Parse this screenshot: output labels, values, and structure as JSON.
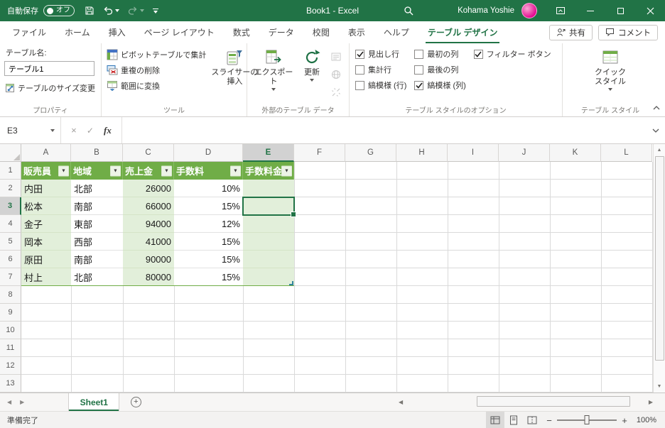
{
  "titlebar": {
    "autosave_label": "自動保存",
    "autosave_state": "オフ",
    "document_title": "Book1 -  Excel",
    "user_name": "Kohama Yoshie"
  },
  "ribbon_tabs": {
    "items": [
      "ファイル",
      "ホーム",
      "挿入",
      "ページ レイアウト",
      "数式",
      "データ",
      "校閲",
      "表示",
      "ヘルプ",
      "テーブル デザイン"
    ],
    "active_tab": "テーブル デザイン",
    "share_label": "共有",
    "comments_label": "コメント"
  },
  "ribbon": {
    "properties_group": {
      "table_name_label": "テーブル名:",
      "table_name_value": "テーブル1",
      "resize_button": "テーブルのサイズ変更",
      "group_title": "プロパティ"
    },
    "tools_group": {
      "summarize_pivot": "ピボットテーブルで集計",
      "remove_duplicates": "重複の削除",
      "convert_to_range": "範囲に変換",
      "insert_slicer": "スライサーの挿入",
      "group_title": "ツール"
    },
    "external_group": {
      "export_label": "エクスポート",
      "refresh_label": "更新",
      "group_title": "外部のテーブル データ"
    },
    "style_options_group": {
      "options": [
        {
          "label": "見出し行",
          "checked": true
        },
        {
          "label": "集計行",
          "checked": false
        },
        {
          "label": "縞模様 (行)",
          "checked": false
        },
        {
          "label": "最初の列",
          "checked": false
        },
        {
          "label": "最後の列",
          "checked": false
        },
        {
          "label": "縞模様 (列)",
          "checked": true
        },
        {
          "label": "フィルター ボタン",
          "checked": true
        }
      ],
      "group_title": "テーブル スタイルのオプション"
    },
    "table_styles_group": {
      "quick_styles_label": "クイック スタイル",
      "group_title": "テーブル スタイル"
    }
  },
  "formula_bar": {
    "name_box": "E3",
    "fx_label": "fx",
    "formula_value": ""
  },
  "grid": {
    "column_headers": [
      "A",
      "B",
      "C",
      "D",
      "E",
      "F",
      "G",
      "H",
      "I",
      "J",
      "K",
      "L"
    ],
    "row_headers": [
      "1",
      "2",
      "3",
      "4",
      "5",
      "6",
      "7",
      "8",
      "9",
      "10",
      "11",
      "12",
      "13"
    ],
    "active_cell": "E3",
    "table": {
      "headers": [
        "販売員",
        "地域",
        "売上金",
        "手数料",
        "手数料金"
      ],
      "rows": [
        [
          "内田",
          "北部",
          "26000",
          "10%",
          ""
        ],
        [
          "松本",
          "南部",
          "66000",
          "15%",
          ""
        ],
        [
          "金子",
          "東部",
          "94000",
          "12%",
          ""
        ],
        [
          "岡本",
          "西部",
          "41000",
          "15%",
          ""
        ],
        [
          "原田",
          "南部",
          "90000",
          "15%",
          ""
        ],
        [
          "村上",
          "北部",
          "80000",
          "15%",
          ""
        ]
      ]
    }
  },
  "sheet_bar": {
    "active_sheet": "Sheet1"
  },
  "status_bar": {
    "status": "準備完了",
    "zoom_value": "100%"
  },
  "colors": {
    "excel_green": "#217346",
    "table_header_green": "#70AD47",
    "banded_column_green": "#E2EFDA"
  }
}
